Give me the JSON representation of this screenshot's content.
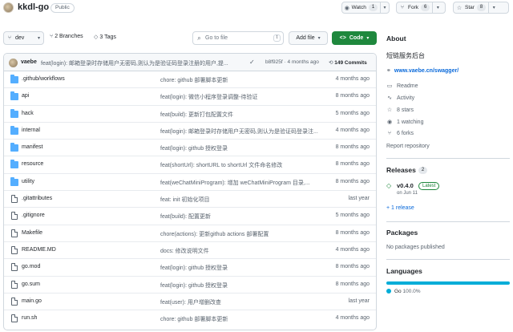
{
  "repo": {
    "name": "kkdl-go",
    "visibility": "Public"
  },
  "actions": {
    "watch": {
      "label": "Watch",
      "count": "1"
    },
    "fork": {
      "label": "Fork",
      "count": "6"
    },
    "star": {
      "label": "Star",
      "count": "8"
    }
  },
  "toolbar": {
    "branch": "dev",
    "branches": "2 Branches",
    "tags": "3 Tags",
    "goto_placeholder": "Go to file",
    "goto_key": "t",
    "add_file": "Add file",
    "code": "Code"
  },
  "latest_commit": {
    "author": "vaebe",
    "message": "feat(login): 邮箱登录时存储用户无密码,则认为是验证码登录注册的用户,提...",
    "hash_time": "b8f925f · 4 months ago",
    "commits": "149 Commits"
  },
  "files": [
    {
      "type": "folder",
      "name": ".github/workflows",
      "message": "chore: github 部署脚本更新",
      "time": "4 months ago"
    },
    {
      "type": "folder",
      "name": "api",
      "message": "feat(login): 微信小程序登录调整-待验证",
      "time": "8 months ago"
    },
    {
      "type": "folder",
      "name": "hack",
      "message": "feat(build): 更新打包配置文件",
      "time": "5 months ago"
    },
    {
      "type": "folder",
      "name": "internal",
      "message": "feat(login): 邮箱登录时存储用户无密码,则认为是验证码登录注...",
      "time": "4 months ago"
    },
    {
      "type": "folder",
      "name": "manifest",
      "message": "feat(login): github 授权登录",
      "time": "8 months ago"
    },
    {
      "type": "folder",
      "name": "resource",
      "message": "feat(shortUrl): shortURL to shortUrl 文件命名修改",
      "time": "8 months ago"
    },
    {
      "type": "folder",
      "name": "utility",
      "message": "feat(weChatMiniProgram): 增加 weChatMiniProgram 目录,...",
      "time": "8 months ago"
    },
    {
      "type": "file",
      "name": ".gitattributes",
      "message": "feat: init 初始化项目",
      "time": "last year"
    },
    {
      "type": "file",
      "name": ".gitignore",
      "message": "feat(build): 配置更新",
      "time": "5 months ago"
    },
    {
      "type": "file",
      "name": "Makefile",
      "message": "chore(actions): 更新github actions 部署配置",
      "time": "8 months ago"
    },
    {
      "type": "file",
      "name": "README.MD",
      "message": "docs: 修改说明文件",
      "time": "4 months ago"
    },
    {
      "type": "file",
      "name": "go.mod",
      "message": "feat(login): github 授权登录",
      "time": "8 months ago"
    },
    {
      "type": "file",
      "name": "go.sum",
      "message": "feat(login): github 授权登录",
      "time": "8 months ago"
    },
    {
      "type": "file",
      "name": "main.go",
      "message": "feat(user): 用户增删改查",
      "time": "last year"
    },
    {
      "type": "file",
      "name": "run.sh",
      "message": "chore: github 部署脚本更新",
      "time": "4 months ago"
    }
  ],
  "about": {
    "title": "About",
    "description": "短链服务后台",
    "link": "www.vaebe.cn/swagger/",
    "items": [
      {
        "icon": "book-icon",
        "label": "Readme"
      },
      {
        "icon": "pulse-icon",
        "label": "Activity"
      },
      {
        "icon": "star-icon",
        "label": "8 stars"
      },
      {
        "icon": "eye-icon",
        "label": "1 watching"
      },
      {
        "icon": "fork-icon",
        "label": "6 forks"
      }
    ],
    "report": "Report repository"
  },
  "releases": {
    "title": "Releases",
    "count": "2",
    "version": "v0.4.0",
    "badge": "Latest",
    "date": "on Jun 11",
    "more": "+ 1 release"
  },
  "packages": {
    "title": "Packages",
    "empty": "No packages published"
  },
  "languages": {
    "title": "Languages",
    "name": "Go",
    "percent": "100.0%",
    "color": "#00add8"
  }
}
